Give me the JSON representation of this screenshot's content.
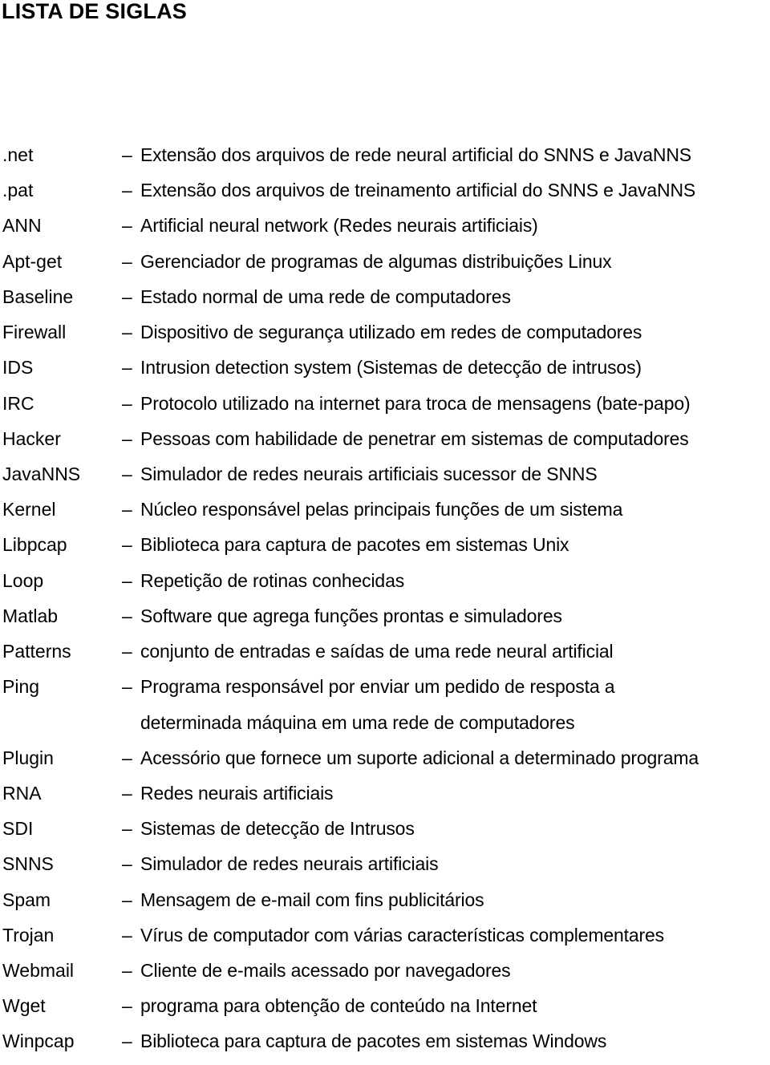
{
  "page": {
    "title": "LISTA DE SIGLAS"
  },
  "separator": "–",
  "entries": [
    {
      "term": ".net",
      "definition": "Extensão dos arquivos de rede neural artificial do SNNS e JavaNNS"
    },
    {
      "term": ".pat",
      "definition": "Extensão dos arquivos de treinamento artificial do SNNS e JavaNNS"
    },
    {
      "term": "ANN",
      "definition": "Artificial neural network (Redes neurais artificiais)"
    },
    {
      "term": "Apt-get",
      "definition": "Gerenciador de programas de algumas distribuições Linux"
    },
    {
      "term": "Baseline",
      "definition": "Estado normal de uma rede de computadores"
    },
    {
      "term": "Firewall",
      "definition": "Dispositivo de segurança utilizado em redes de computadores"
    },
    {
      "term": "IDS",
      "definition": "Intrusion detection system (Sistemas de detecção de intrusos)"
    },
    {
      "term": "IRC",
      "definition": "Protocolo utilizado na internet para troca de mensagens (bate-papo)"
    },
    {
      "term": "Hacker",
      "definition": "Pessoas com habilidade de penetrar em sistemas de computadores"
    },
    {
      "term": "JavaNNS",
      "definition": "Simulador de redes neurais artificiais sucessor de SNNS"
    },
    {
      "term": "Kernel",
      "definition": "Núcleo responsável pelas principais funções de um sistema"
    },
    {
      "term": "Libpcap",
      "definition": "Biblioteca para captura de pacotes em sistemas Unix"
    },
    {
      "term": "Loop",
      "definition": "Repetição de rotinas conhecidas"
    },
    {
      "term": "Matlab",
      "definition": "Software que agrega funções prontas e simuladores"
    },
    {
      "term": "Patterns",
      "definition": "conjunto de entradas e saídas de uma rede neural artificial"
    },
    {
      "term": "Ping",
      "definition": "Programa responsável por enviar um pedido de resposta a",
      "continuation": "determinada máquina em uma rede de computadores"
    },
    {
      "term": "Plugin",
      "definition": "Acessório que fornece um suporte adicional a determinado programa"
    },
    {
      "term": "RNA",
      "definition": "Redes neurais artificiais"
    },
    {
      "term": "SDI",
      "definition": "Sistemas de detecção de Intrusos"
    },
    {
      "term": "SNNS",
      "definition": "Simulador de redes neurais artificiais"
    },
    {
      "term": "Spam",
      "definition": "Mensagem de e-mail com fins publicitários"
    },
    {
      "term": "Trojan",
      "definition": "Vírus de computador com várias características complementares"
    },
    {
      "term": "Webmail",
      "definition": "Cliente de e-mails acessado por navegadores"
    },
    {
      "term": "Wget",
      "definition": "programa para obtenção de conteúdo na Internet"
    },
    {
      "term": "Winpcap",
      "definition": "Biblioteca para captura de pacotes em sistemas Windows"
    }
  ]
}
